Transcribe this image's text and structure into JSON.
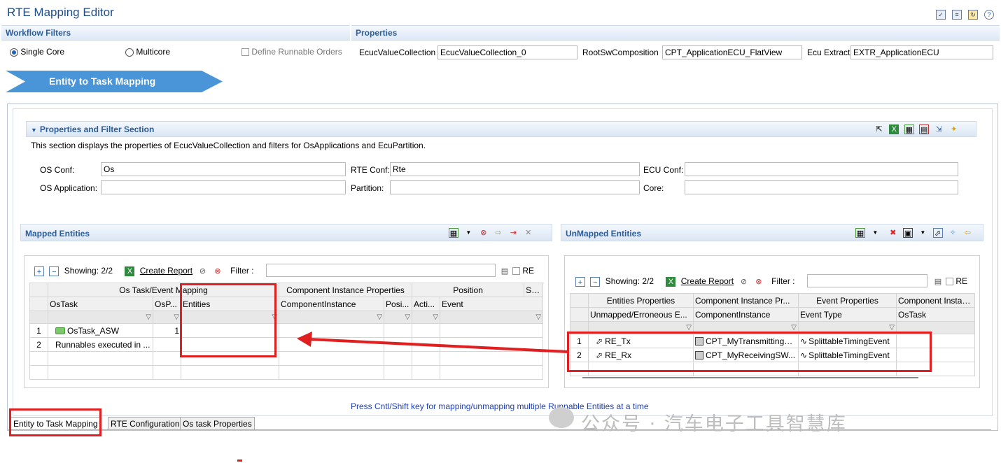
{
  "window": {
    "title": "RTE Mapping Editor"
  },
  "workflow": {
    "title": "Workflow Filters",
    "single_core": "Single Core",
    "multicore": "Multicore",
    "define_runnable": "Define Runnable Orders"
  },
  "properties": {
    "title": "Properties",
    "ecuc_label": "EcucValueCollection",
    "ecuc_value": "EcucValueCollection_0",
    "root_label": "RootSwComposition",
    "root_value": "CPT_ApplicationECU_FlatView",
    "extract_label": "Ecu Extract",
    "extract_value": "EXTR_ApplicationECU"
  },
  "banner": {
    "label": "Entity to Task Mapping"
  },
  "filter_section": {
    "title": "Properties and Filter Section",
    "description": "This section displays the properties of EcucValueCollection and filters for OsApplications and EcuPartition.",
    "os_conf_label": "OS Conf:",
    "os_conf_value": "Os",
    "rte_conf_label": "RTE Conf:",
    "rte_conf_value": "Rte",
    "ecu_conf_label": "ECU Conf:",
    "ecu_conf_value": "",
    "os_app_label": "OS Application:",
    "os_app_value": "",
    "partition_label": "Partition:",
    "partition_value": "",
    "core_label": "Core:",
    "core_value": ""
  },
  "mapped": {
    "title": "Mapped Entities",
    "showing": "Showing: 2/2",
    "create_report": "Create Report",
    "filter_label": "Filter :",
    "filter_value": "",
    "re_label": "RE",
    "group_headers": [
      "Os Task/Event Mapping",
      "Component Instance Properties",
      "Position",
      "Swc Event Properti..."
    ],
    "col_headers": [
      "OsTask",
      "OsP...",
      "Entities",
      "ComponentInstance",
      "Posi...",
      "Acti...",
      "Event"
    ],
    "rows": [
      {
        "num": "1",
        "task": "OsTask_ASW",
        "osp": "1"
      },
      {
        "num": "2",
        "task": "Runnables executed in ...",
        "osp": ""
      }
    ]
  },
  "unmapped": {
    "title": "UnMapped Entities",
    "showing": "Showing: 2/2",
    "create_report": "Create Report",
    "filter_label": "Filter :",
    "filter_value": "",
    "re_label": "RE",
    "group_headers": [
      "Entities Properties",
      "Component Instance Pr...",
      "Event Properties",
      "Component Instance"
    ],
    "col_headers": [
      "Unmapped/Erroneous E...",
      "ComponentInstance",
      "Event Type",
      "OsTask"
    ],
    "rows": [
      {
        "num": "1",
        "entity": "RE_Tx",
        "component": "CPT_MyTransmittingS...",
        "event": "SplittableTimingEvent"
      },
      {
        "num": "2",
        "entity": "RE_Rx",
        "component": "CPT_MyReceivingSW...",
        "event": "SplittableTimingEvent"
      }
    ]
  },
  "hint": "Press Cntl/Shift key for mapping/unmapping multiple Runnable Entities at a time",
  "tabs": [
    "Entity to Task Mapping",
    "RTE Configuration",
    "Os task Properties"
  ],
  "watermark": "公众号 · 汽车电子工具智慧库",
  "colors": {
    "accent": "#2b5d9a",
    "banner": "#4a95d8",
    "highlight": "#e02020"
  }
}
